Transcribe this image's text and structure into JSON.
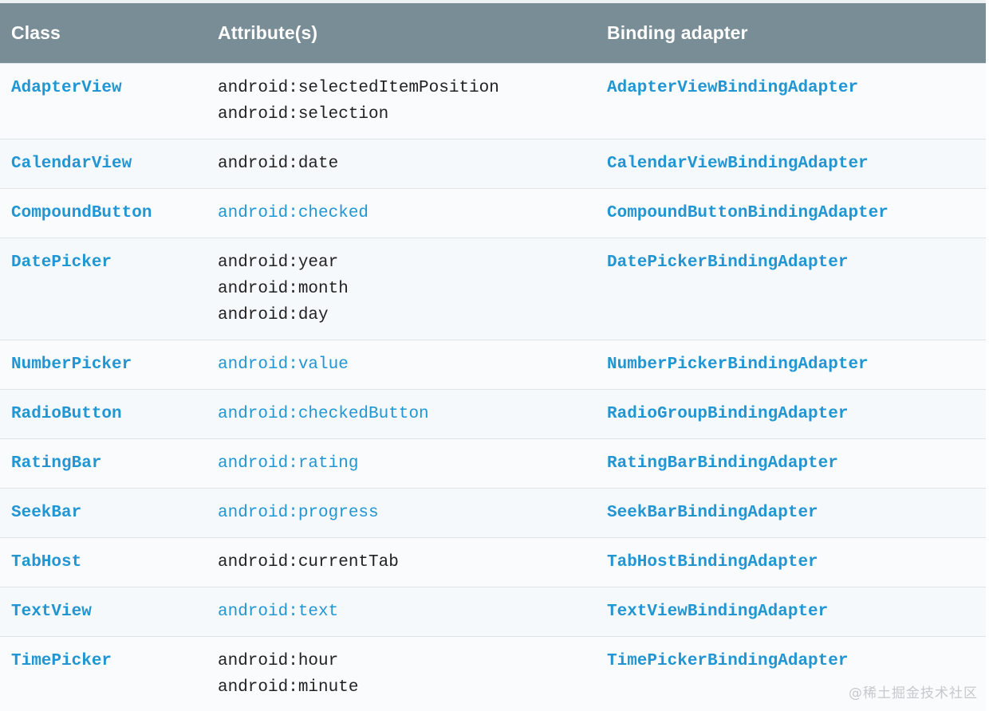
{
  "table": {
    "headers": [
      {
        "label": "Class"
      },
      {
        "label": "Attribute(s)"
      },
      {
        "label": "Binding adapter"
      }
    ],
    "rows": [
      {
        "class_name": "AdapterView",
        "class_link": true,
        "attributes": "android:selectedItemPosition\nandroid:selection",
        "attributes_link": false,
        "adapter": "AdapterViewBindingAdapter",
        "adapter_link": true
      },
      {
        "class_name": "CalendarView",
        "class_link": true,
        "attributes": "android:date",
        "attributes_link": false,
        "adapter": "CalendarViewBindingAdapter",
        "adapter_link": true
      },
      {
        "class_name": "CompoundButton",
        "class_link": true,
        "attributes": "android:checked",
        "attributes_link": true,
        "adapter": "CompoundButtonBindingAdapter",
        "adapter_link": true
      },
      {
        "class_name": "DatePicker",
        "class_link": true,
        "attributes": "android:year\nandroid:month\nandroid:day",
        "attributes_link": false,
        "adapter": "DatePickerBindingAdapter",
        "adapter_link": true
      },
      {
        "class_name": "NumberPicker",
        "class_link": true,
        "attributes": "android:value",
        "attributes_link": true,
        "adapter": "NumberPickerBindingAdapter",
        "adapter_link": true
      },
      {
        "class_name": "RadioButton",
        "class_link": true,
        "attributes": "android:checkedButton",
        "attributes_link": true,
        "adapter": "RadioGroupBindingAdapter",
        "adapter_link": true
      },
      {
        "class_name": "RatingBar",
        "class_link": true,
        "attributes": "android:rating",
        "attributes_link": true,
        "adapter": "RatingBarBindingAdapter",
        "adapter_link": true
      },
      {
        "class_name": "SeekBar",
        "class_link": true,
        "attributes": "android:progress",
        "attributes_link": true,
        "adapter": "SeekBarBindingAdapter",
        "adapter_link": true
      },
      {
        "class_name": "TabHost",
        "class_link": true,
        "attributes": "android:currentTab",
        "attributes_link": false,
        "adapter": "TabHostBindingAdapter",
        "adapter_link": true
      },
      {
        "class_name": "TextView",
        "class_link": true,
        "attributes": "android:text",
        "attributes_link": true,
        "adapter": "TextViewBindingAdapter",
        "adapter_link": true
      },
      {
        "class_name": "TimePicker",
        "class_link": true,
        "attributes": "android:hour\nandroid:minute",
        "attributes_link": false,
        "adapter": "TimePickerBindingAdapter",
        "adapter_link": true
      }
    ]
  },
  "watermark": {
    "text": "@稀土掘金技术社区"
  },
  "colors": {
    "header_bg": "#798d96",
    "header_text": "#ffffff",
    "link": "#2196d3",
    "plain_text": "#222222",
    "row_bg": "#f9fbfc",
    "row_bg_alt": "#f6f9fb",
    "row_border": "#dfe4e6",
    "watermark": "#c6c9cb"
  }
}
